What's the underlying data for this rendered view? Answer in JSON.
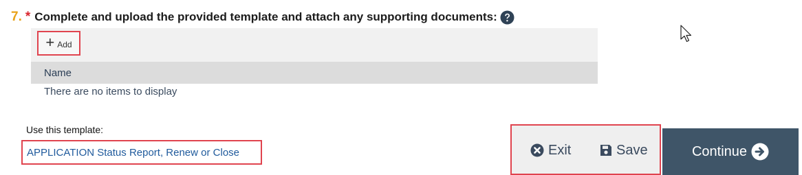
{
  "question": {
    "number": "7.",
    "required_marker": "*",
    "text": "Complete and upload the provided template and attach any supporting documents:",
    "help_icon": "question-circle-icon"
  },
  "grid": {
    "add_label": "Add",
    "add_icon": "plus-icon",
    "columns": [
      "Name"
    ],
    "empty_message": "There are no items to display"
  },
  "template": {
    "label": "Use this template:",
    "link_text": "APPLICATION Status Report, Renew or Close"
  },
  "actions": {
    "exit_label": "Exit",
    "exit_icon": "times-circle-icon",
    "save_label": "Save",
    "save_icon": "floppy-disk-icon",
    "continue_label": "Continue",
    "continue_icon": "arrow-circle-right-icon"
  },
  "colors": {
    "question_number": "#e8a21a",
    "required": "#d9262e",
    "highlight_border": "#e0434e",
    "link": "#1f5a9c",
    "continue_bg": "#3f5568"
  }
}
